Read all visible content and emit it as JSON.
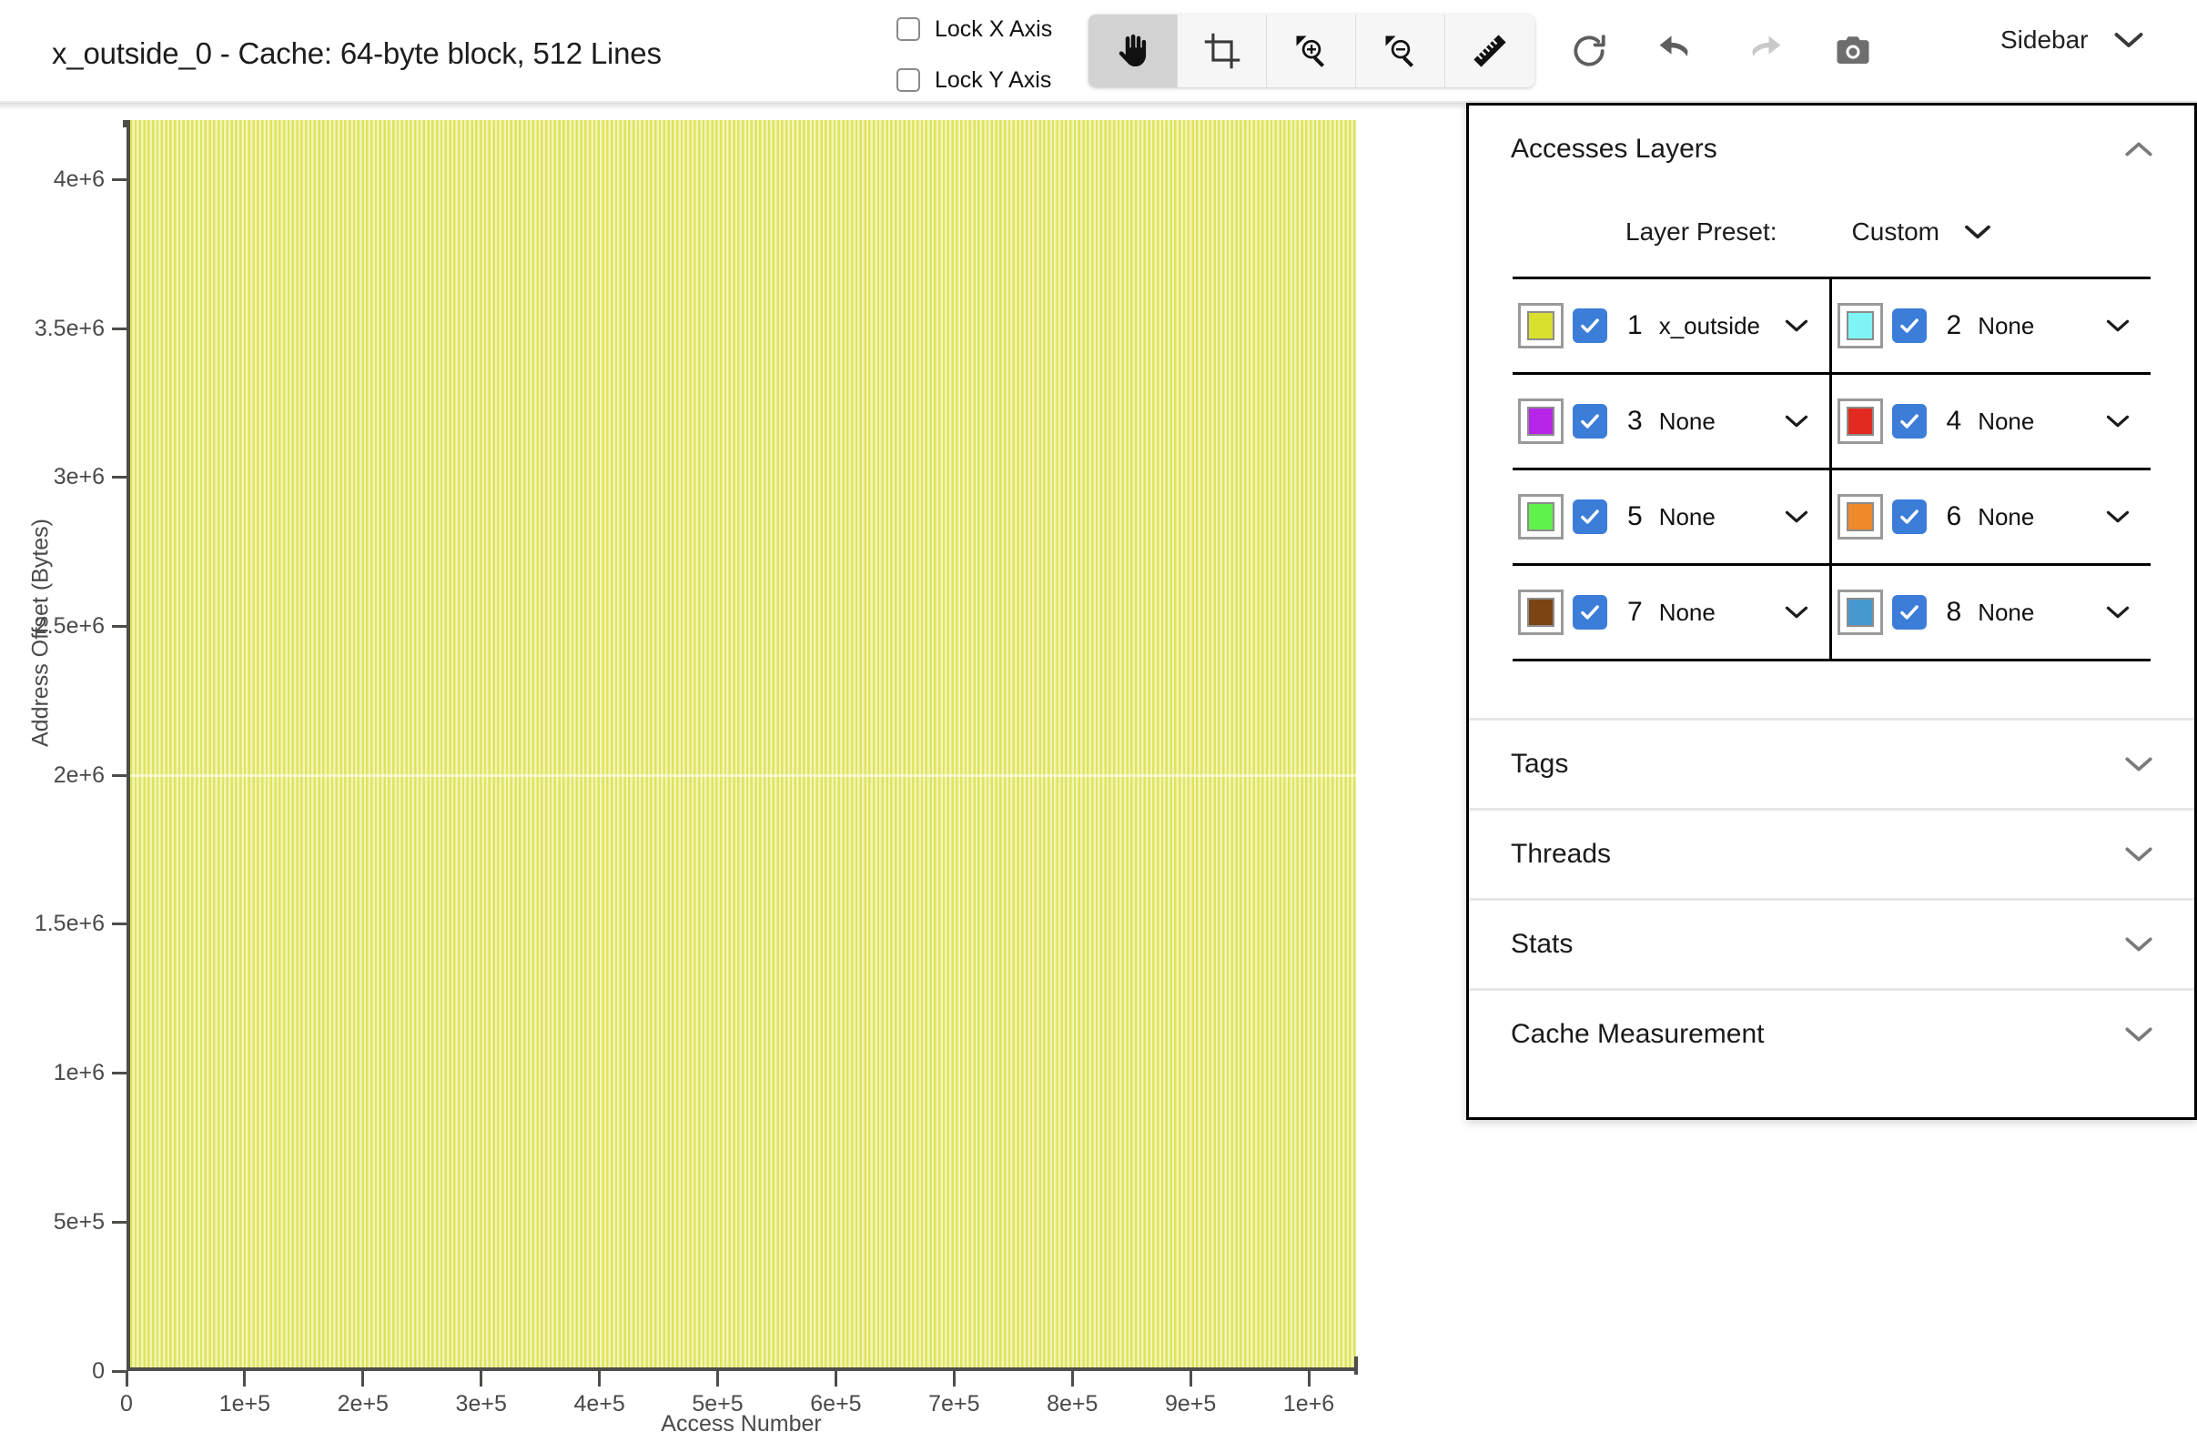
{
  "header": {
    "title": "x_outside_0 - Cache: 64-byte block, 512 Lines",
    "lock_x_label": "Lock X Axis",
    "lock_y_label": "Lock Y Axis",
    "lock_x_checked": false,
    "lock_y_checked": false,
    "sidebar_toggle_label": "Sidebar",
    "tools": [
      {
        "name": "pan-tool",
        "icon": "hand-icon",
        "active": true
      },
      {
        "name": "crop-tool",
        "icon": "crop-icon",
        "active": false
      },
      {
        "name": "zoom-in-tool",
        "icon": "zoom-in-icon",
        "active": false
      },
      {
        "name": "zoom-out-tool",
        "icon": "zoom-out-icon",
        "active": false
      },
      {
        "name": "measure-tool",
        "icon": "ruler-icon",
        "active": false
      }
    ],
    "actions": [
      {
        "name": "reset-button",
        "icon": "refresh-icon",
        "enabled": true
      },
      {
        "name": "undo-button",
        "icon": "undo-icon",
        "enabled": true
      },
      {
        "name": "redo-button",
        "icon": "redo-icon",
        "enabled": false
      },
      {
        "name": "screenshot-button",
        "icon": "camera-icon",
        "enabled": true
      }
    ]
  },
  "chart_data": {
    "type": "area",
    "title": "x_outside_0 - Cache: 64-byte block, 512 Lines",
    "xlabel": "Access Number",
    "ylabel": "Address Offset (Bytes)",
    "grid": false,
    "legend_position": "none",
    "xlim": [
      0,
      1040000
    ],
    "ylim": [
      0,
      4200000
    ],
    "xticks": [
      0,
      100000,
      200000,
      300000,
      400000,
      500000,
      600000,
      700000,
      800000,
      900000,
      1000000
    ],
    "xtick_labels": [
      "0",
      "1e+5",
      "2e+5",
      "3e+5",
      "4e+5",
      "5e+5",
      "6e+5",
      "7e+5",
      "8e+5",
      "9e+5",
      "1e+6"
    ],
    "yticks": [
      0,
      500000,
      1000000,
      1500000,
      2000000,
      2500000,
      3000000,
      3500000,
      4000000
    ],
    "ytick_labels": [
      "0",
      "5e+5",
      "1e+6",
      "1.5e+6",
      "2e+6",
      "2.5e+6",
      "3e+6",
      "3.5e+6",
      "4e+6"
    ],
    "series": [
      {
        "name": "x_outside",
        "color": "#dfe45c",
        "description": "Dense vertical stripes spanning the full access range; address offsets fill 0 to ~4.15e+6 bytes for every access column.",
        "x_range": [
          0,
          1030000
        ],
        "y_range": [
          0,
          4150000
        ]
      }
    ],
    "annotations": []
  },
  "sidebar": {
    "accesses": {
      "title": "Accesses Layers",
      "expanded": true,
      "preset_label": "Layer Preset:",
      "preset_value": "Custom",
      "layers": [
        {
          "index": "1",
          "name": "x_outside",
          "color": "#d9e02e",
          "checked": true
        },
        {
          "index": "2",
          "name": "None",
          "color": "#7ff4f4",
          "checked": true
        },
        {
          "index": "3",
          "name": "None",
          "color": "#b726e8",
          "checked": true
        },
        {
          "index": "4",
          "name": "None",
          "color": "#e32a20",
          "checked": true
        },
        {
          "index": "5",
          "name": "None",
          "color": "#5ef24a",
          "checked": true
        },
        {
          "index": "6",
          "name": "None",
          "color": "#ef8a2c",
          "checked": true
        },
        {
          "index": "7",
          "name": "None",
          "color": "#7a4512",
          "checked": true
        },
        {
          "index": "8",
          "name": "None",
          "color": "#4699ce",
          "checked": true
        }
      ]
    },
    "sections": [
      {
        "label": "Tags",
        "expanded": false
      },
      {
        "label": "Threads",
        "expanded": false
      },
      {
        "label": "Stats",
        "expanded": false
      },
      {
        "label": "Cache Measurement",
        "expanded": false
      }
    ]
  },
  "colors": {
    "accent_checkbox": "#3b7dd8",
    "plot_fill": "#dfe45c",
    "axis": "#4d4d49",
    "panel_border": "#000000"
  }
}
